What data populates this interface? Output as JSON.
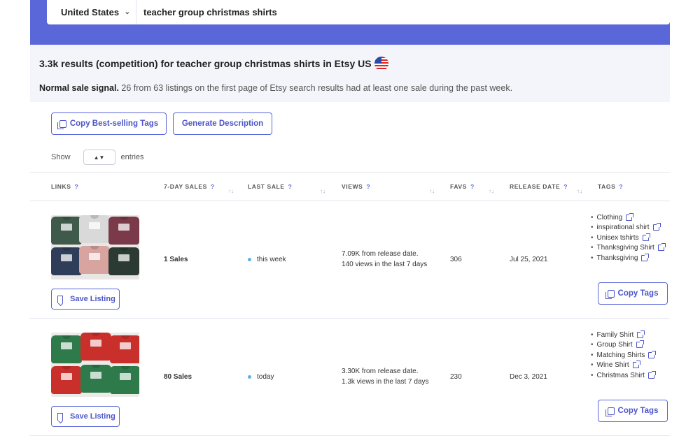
{
  "search": {
    "country": "United States",
    "query": "teacher group christmas shirts"
  },
  "results": {
    "title": "3.3k results (competition) for teacher group christmas shirts in Etsy US",
    "signal_label": "Normal sale signal.",
    "signal_text": " 26 from 63 listings on the first page of Etsy search results had at least one sale during the past week."
  },
  "toolbar": {
    "copy_tags_label": "Copy Best-selling Tags",
    "generate_label": "Generate Description",
    "show_label": "Show",
    "entries_label": "entries"
  },
  "table": {
    "headers": {
      "links": "LINKS",
      "sales": "7-DAY SALES",
      "last_sale": "LAST SALE",
      "views": "VIEWS",
      "favs": "FAVS",
      "release": "RELEASE DATE",
      "tags": "TAGS",
      "help": "?"
    },
    "rows": [
      {
        "sales": "1 Sales",
        "last_sale": "this week",
        "views_release": "7.09K from release date.",
        "views_week": "140 views in the last 7 days",
        "favs": "306",
        "release": "Jul 25, 2021",
        "tags": [
          "Clothing",
          "inspirational shirt",
          "Unisex tshirts",
          "Thanksgiving Shirt",
          "Thanksgiving"
        ],
        "save_label": "Save Listing",
        "copy_label": "Copy Tags"
      },
      {
        "sales": "80 Sales",
        "last_sale": "today",
        "views_release": "3.30K from release date.",
        "views_week": "1.3k views in the last 7 days",
        "favs": "230",
        "release": "Dec 3, 2021",
        "tags": [
          "Family Shirt",
          "Group Shirt",
          "Matching Shirts",
          "Wine Shirt",
          "Christmas Shirt"
        ],
        "save_label": "Save Listing",
        "copy_label": "Copy Tags"
      }
    ]
  },
  "colors": {
    "accent": "#5a67d8",
    "background": "#f4f5fb"
  }
}
